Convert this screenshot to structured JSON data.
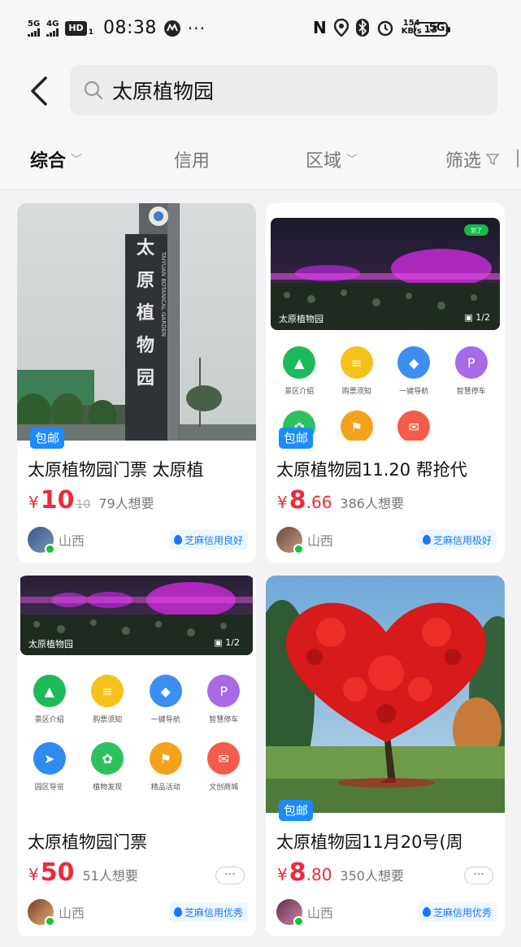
{
  "status_bar": {
    "sig1_label": "5G",
    "sig2_label": "4G",
    "hd": "HD",
    "hd_sub": "1",
    "time": "08:38",
    "more": "···",
    "netspeed_value": "154",
    "netspeed_unit": "KB/s",
    "network": "5G",
    "network_sub": "1",
    "battery": "13"
  },
  "search": {
    "query": "太原植物园"
  },
  "tabs": [
    {
      "label": "综合",
      "active": true
    },
    {
      "label": "信用",
      "active": false
    },
    {
      "label": "区域",
      "active": false
    },
    {
      "label": "筛选",
      "active": false
    }
  ],
  "appshot": {
    "photo_label": "太原植物园",
    "page_indicator": "1/2",
    "green_tag": "到了",
    "icons_row1": [
      "景区介绍",
      "购票须知",
      "一键导航",
      "智慧停车"
    ],
    "icons_row2": [
      "园区导览",
      "植物发现",
      "精品活动",
      "文创商城"
    ]
  },
  "sign_text": "太原植物园",
  "sign_subtext": "TAIYUAN BOTANICAL GARDEN",
  "items": [
    {
      "badge": "包邮",
      "title": "太原植物园门票 太原植",
      "price_yen": "¥",
      "price_int": "10",
      "price_dec": "",
      "price_orig": "10",
      "want": "79人想要",
      "location": "山西",
      "credit": "芝麻信用良好"
    },
    {
      "badge": "包邮",
      "title": "太原植物园11.20  帮抢代",
      "price_yen": "¥",
      "price_int": "8",
      "price_dec": ".66",
      "price_orig": "",
      "want": "386人想要",
      "location": "山西",
      "credit": "芝麻信用极好"
    },
    {
      "badge": "",
      "title": "太原植物园门票",
      "price_yen": "¥",
      "price_int": "50",
      "price_dec": "",
      "price_orig": "",
      "want": "51人想要",
      "location": "山西",
      "credit": "芝麻信用优秀",
      "more": "···"
    },
    {
      "badge": "包邮",
      "title": "太原植物园11月20号(周",
      "price_yen": "¥",
      "price_int": "8",
      "price_dec": ".80",
      "price_orig": "",
      "want": "350人想要",
      "location": "山西",
      "credit": "芝麻信用优秀",
      "more": "···"
    }
  ]
}
